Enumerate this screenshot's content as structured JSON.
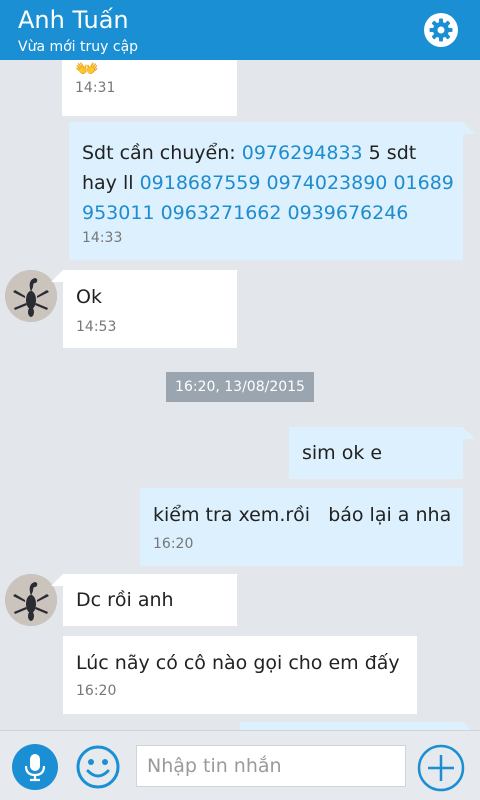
{
  "header": {
    "title": "Anh Tuấn",
    "subtitle": "Vừa mới truy cập"
  },
  "messages": [
    {
      "direction": "incoming",
      "emoji": "👐",
      "time": "14:31"
    },
    {
      "direction": "outgoing",
      "lines": [
        [
          "Sdt cần chuyển: ",
          "0976294833",
          " 5 sdt"
        ],
        [
          "hay ll ",
          "0918687559",
          " ",
          "0974023890",
          " ",
          "01689"
        ],
        [
          "953011",
          " ",
          "0963271662",
          " ",
          "0939676246"
        ]
      ],
      "time": "14:33"
    },
    {
      "direction": "incoming",
      "text": "Ok",
      "time": "14:53"
    },
    {
      "direction": "outgoing",
      "text": "sim ok e"
    },
    {
      "direction": "outgoing",
      "text": "kiểm tra xem.rồi   báo lại a nha",
      "time": "16:20"
    },
    {
      "direction": "incoming",
      "text": "Dc rồi anh"
    },
    {
      "direction": "incoming",
      "text": "Lúc nãy có cô nào gọi cho em đấy",
      "time": "16:20"
    }
  ],
  "date_separator": "16:20, 13/08/2015",
  "composer": {
    "placeholder": "Nhập tin nhắn"
  },
  "colors": {
    "accent": "#1b8fd3",
    "link": "#1e8ccf",
    "outgoing_bubble": "#dcf0fd",
    "incoming_bubble": "#ffffff"
  },
  "icons": {
    "settings": "gear-icon",
    "mic": "microphone-icon",
    "emoji": "smiley-icon",
    "add": "plus-icon"
  }
}
